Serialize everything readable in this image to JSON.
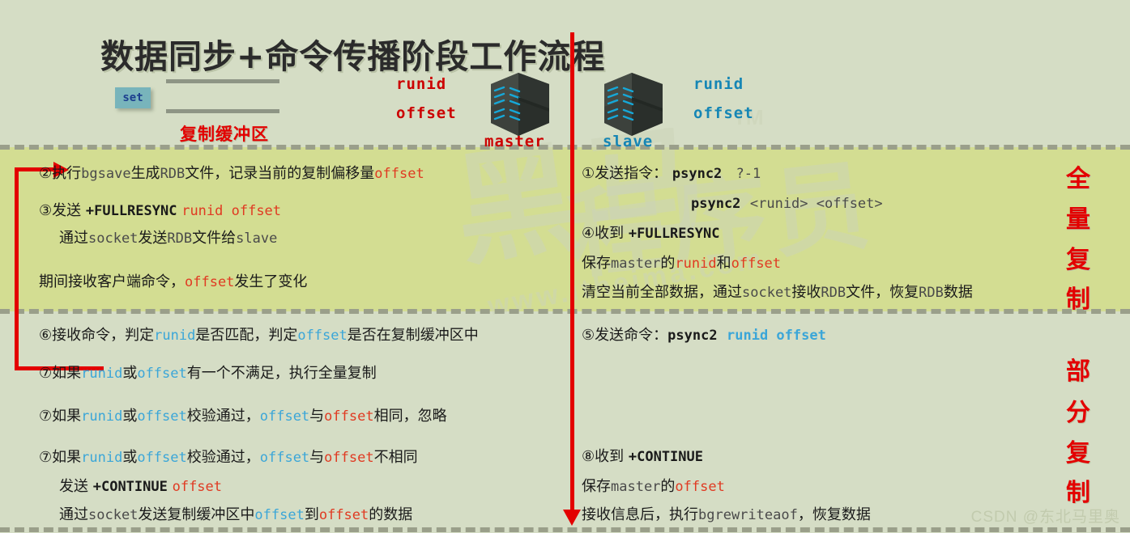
{
  "title": "数据同步+命令传播阶段工作流程",
  "header": {
    "set_label": "set",
    "buffer_label": "复制缓冲区",
    "master": {
      "runid": "runid",
      "offset": "offset",
      "name": "master"
    },
    "slave": {
      "runid": "runid",
      "offset": "offset",
      "name": "slave"
    }
  },
  "watermarks": {
    "big": "黑马",
    "mid": "程序员",
    "url": "www.itheima.com",
    "tm": "TM",
    "csdn": "CSDN @东北马里奥"
  },
  "side_labels": {
    "full": "全量复制",
    "full_chars": [
      "全",
      "量",
      "复",
      "制"
    ],
    "partial": "部分复制",
    "partial_chars": [
      "部",
      "分",
      "复",
      "制"
    ]
  },
  "master_full": {
    "step2": {
      "num": "②",
      "cn1": "执行",
      "code1": "bgsave",
      "cn2": "生成",
      "code2": "RDB",
      "cn3": "文件，记录当前的复制偏移量",
      "code3": "offset"
    },
    "step3": {
      "num": "③",
      "cn1": "发送",
      "kw": "+FULLRESYNC",
      "args": "runid offset"
    },
    "step3b": {
      "cn1": "通过",
      "code1": "socket",
      "cn2": "发送",
      "code2": "RDB",
      "cn3": "文件给",
      "code3": "slave"
    },
    "note": {
      "cn1": "期间接收客户端命令，",
      "code1": "offset",
      "cn2": "发生了变化"
    }
  },
  "slave_full": {
    "step1": {
      "num": "①",
      "cn1": "发送指令：",
      "kw": "psync2",
      "args": "?-1"
    },
    "step1b": {
      "kw": "psync2",
      "args": "<runid> <offset>"
    },
    "step4": {
      "num": "④",
      "cn1": "收到",
      "kw": "+FULLRESYNC"
    },
    "save": {
      "cn1": "保存",
      "code1": "master",
      "cn2": "的",
      "code2": "runid",
      "cn3": "和",
      "code3": "offset"
    },
    "clear": {
      "cn1": "清空当前全部数据，通过",
      "code1": "socket",
      "cn2": "接收",
      "code2": "RDB",
      "cn3": "文件，恢复",
      "code3": "RDB",
      "cn4": "数据"
    }
  },
  "master_partial": {
    "step6": {
      "num": "⑥",
      "cn1": "接收命令，判定",
      "code1": "runid",
      "cn2": "是否匹配，判定",
      "code2": "offset",
      "cn3": "是否在复制缓冲区中"
    },
    "step7a": {
      "num": "⑦",
      "cn1": "如果",
      "code1": "runid",
      "cn2": "或",
      "code2": "offset",
      "cn3": "有一个不满足，执行全量复制"
    },
    "step7b": {
      "num": "⑦",
      "cn1": "如果",
      "code1": "runid",
      "cn2": "或",
      "code2": "offset",
      "cn3": "校验通过，",
      "code3": "offset",
      "cn4": "与",
      "code4": "offset",
      "cn5": "相同，忽略"
    },
    "step7c": {
      "num": "⑦",
      "cn1": "如果",
      "code1": "runid",
      "cn2": "或",
      "code2": "offset",
      "cn3": "校验通过，",
      "code3": "offset",
      "cn4": "与",
      "code4": "offset",
      "cn5": "不相同"
    },
    "step7c_send": {
      "cn1": "发送",
      "kw": "+CONTINUE",
      "args": "offset"
    },
    "step7c_sock": {
      "cn1": "通过",
      "code1": "socket",
      "cn2": "发送复制缓冲区中",
      "code2": "offset",
      "cn3": "到",
      "code3": "offset",
      "cn4": "的数据"
    }
  },
  "slave_partial": {
    "step5": {
      "num": "⑤",
      "cn1": "发送命令：",
      "kw": "psync2",
      "args": "runid offset"
    },
    "step8": {
      "num": "⑧",
      "cn1": "收到",
      "kw": "+CONTINUE"
    },
    "save": {
      "cn1": "保存",
      "code1": "master",
      "cn2": "的",
      "code2": "offset"
    },
    "recv": {
      "cn1": "接收信息后，执行",
      "code1": "bgrewriteaof",
      "cn2": "，恢复数据"
    }
  },
  "colors": {
    "band_outer": "#d5ddc5",
    "band_middle": "#d3dd92",
    "red": "#e30000",
    "master_accent": "#e03a22",
    "slave_accent": "#3ba6d8",
    "set_box": "#78b4bb",
    "dash": "#9a9f8a"
  }
}
